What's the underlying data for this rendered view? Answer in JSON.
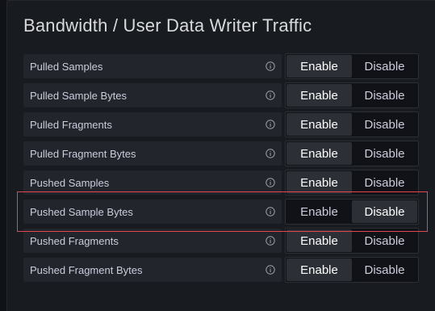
{
  "panel": {
    "title": "Bandwidth / User Data Writer Traffic"
  },
  "options": {
    "enable_label": "Enable",
    "disable_label": "Disable"
  },
  "rows": [
    {
      "label": "Pulled Samples",
      "selected": "Enable"
    },
    {
      "label": "Pulled Sample Bytes",
      "selected": "Enable"
    },
    {
      "label": "Pulled Fragments",
      "selected": "Enable"
    },
    {
      "label": "Pulled Fragment Bytes",
      "selected": "Enable"
    },
    {
      "label": "Pushed Samples",
      "selected": "Enable"
    },
    {
      "label": "Pushed Sample Bytes",
      "selected": "Disable"
    },
    {
      "label": "Pushed Fragments",
      "selected": "Enable"
    },
    {
      "label": "Pushed Fragment Bytes",
      "selected": "Enable"
    }
  ],
  "colors": {
    "background": "#111217",
    "panel": "#181b1f",
    "label_bg": "#22252b",
    "active_option": "#2c2f36",
    "highlight": "#e0474f"
  },
  "icons": {
    "info": "info-circle-icon"
  }
}
